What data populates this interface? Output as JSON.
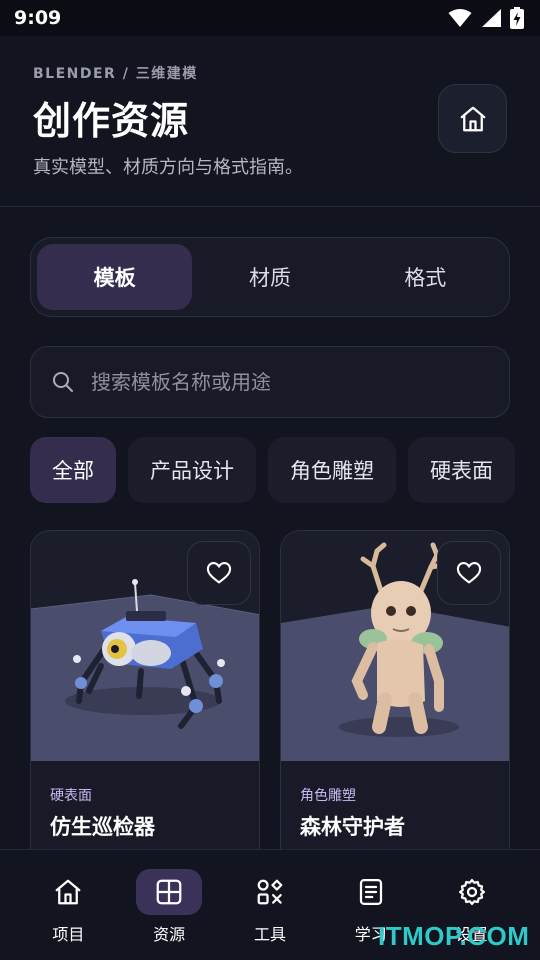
{
  "status": {
    "time": "9:09",
    "icons": [
      "wifi-icon",
      "signal-icon",
      "battery-charging-icon"
    ]
  },
  "header": {
    "eyebrow": "BLENDER / 三维建模",
    "title": "创作资源",
    "subtitle": "真实模型、材质方向与格式指南。",
    "home_icon": "home-icon"
  },
  "segments": [
    {
      "label": "模板",
      "active": true
    },
    {
      "label": "材质",
      "active": false
    },
    {
      "label": "格式",
      "active": false
    }
  ],
  "search": {
    "placeholder": "搜索模板名称或用途",
    "value": "",
    "icon": "search-icon"
  },
  "chips": [
    {
      "label": "全部",
      "active": true
    },
    {
      "label": "产品设计",
      "active": false
    },
    {
      "label": "角色雕塑",
      "active": false
    },
    {
      "label": "硬表面",
      "active": false
    }
  ],
  "cards": [
    {
      "category": "硬表面",
      "title": "仿生巡检器",
      "favorite_icon": "heart-icon"
    },
    {
      "category": "角色雕塑",
      "title": "森林守护者",
      "favorite_icon": "heart-icon"
    }
  ],
  "nav": [
    {
      "label": "项目",
      "icon": "home-icon",
      "active": false
    },
    {
      "label": "资源",
      "icon": "grid-icon",
      "active": true
    },
    {
      "label": "工具",
      "icon": "tools-icon",
      "active": false
    },
    {
      "label": "学习",
      "icon": "document-icon",
      "active": false
    },
    {
      "label": "设置",
      "icon": "gear-icon",
      "active": false
    }
  ],
  "watermark": "ITMOP.COM",
  "colors": {
    "background": "#121420",
    "accent": "#342d4e",
    "category_text": "#c9b8f0",
    "watermark": "#2fc9c9"
  }
}
